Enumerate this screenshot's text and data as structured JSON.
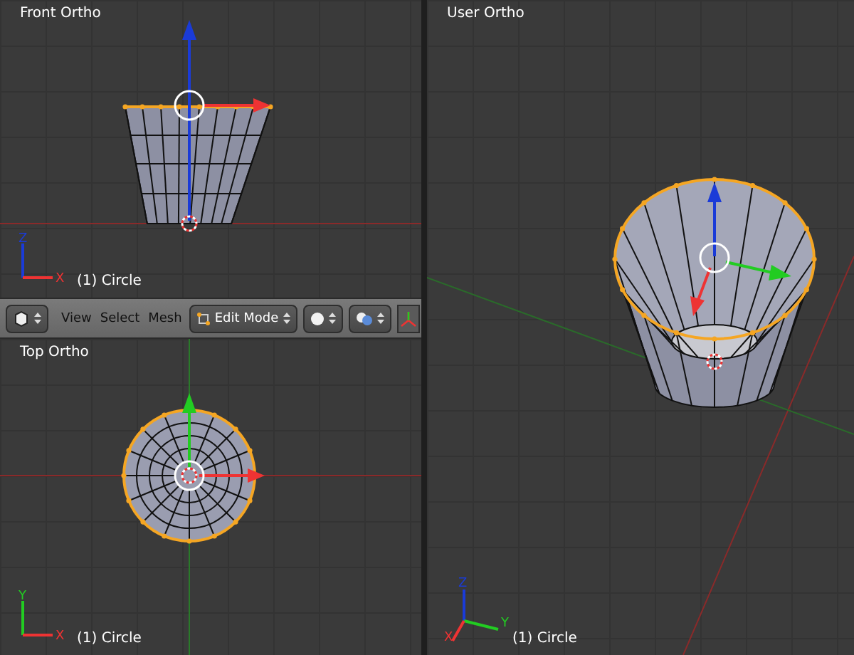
{
  "viewports": [
    {
      "kind": "front",
      "title": "Front Ortho",
      "object": "(1) Circle",
      "axes": [
        "Z",
        "X"
      ]
    },
    {
      "kind": "top",
      "title": "Top Ortho",
      "object": "(1) Circle",
      "axes": [
        "Y",
        "X"
      ]
    },
    {
      "kind": "user",
      "title": "User Ortho",
      "object": "(1) Circle",
      "axes": [
        "Z",
        "Y",
        "X"
      ]
    }
  ],
  "header": {
    "menus": [
      "View",
      "Select",
      "Mesh"
    ],
    "mode": "Edit Mode"
  }
}
